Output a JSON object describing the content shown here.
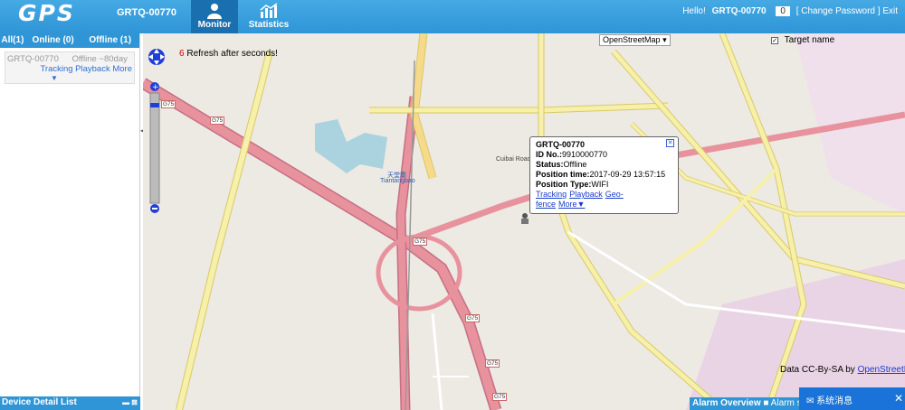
{
  "header": {
    "logo": "GPS",
    "device": "GRTQ-00770",
    "nav": [
      {
        "label": "Monitor",
        "active": true
      },
      {
        "label": "Statistics",
        "active": false
      }
    ],
    "hello": "Hello!",
    "user": "GRTQ-00770",
    "badge": "0",
    "change_password": "[ Change Password ]",
    "exit": "Exit"
  },
  "sidebar": {
    "tabs": {
      "all": "All(1)",
      "online": "Online (0)",
      "offline": "Offline (1)"
    },
    "device": {
      "name": "GRTQ-00770",
      "status": "Offline ~80day",
      "links": "Tracking Playback More",
      "arrow": "▼"
    },
    "detail_title": "Device Detail List"
  },
  "map": {
    "refresh_count": "6",
    "refresh_text": "Refresh after seconds!",
    "layer": "OpenStreetMap",
    "target_name": "Target name",
    "popup": {
      "title": "GRTQ-00770",
      "id_label": "ID No.:",
      "id_value": "9910000770",
      "status_label": "Status:",
      "status_value": "Offline",
      "time_label": "Position time:",
      "time_value": "2017-09-29 13:57:15",
      "type_label": "Position Type:",
      "type_value": "WIFI",
      "links": [
        "Tracking",
        "Playback",
        "Geo-fence",
        "More▼"
      ]
    },
    "credit_text": "Data CC-By-SA by",
    "credit_link": "OpenStreetMap",
    "labels": {
      "tiantang_cn": "天堂寨",
      "tiantang": "Tiantangbao",
      "cuibai": "Cuibai Road"
    },
    "road_shield": "G75"
  },
  "alarm": {
    "title": "Alarm Overview",
    "text": "Alarm so"
  },
  "sysmsg": {
    "title": "系统消息"
  },
  "colors": {
    "header": "#2f95d6",
    "highway": "#e8929e",
    "primary": "#f7f0a8"
  }
}
